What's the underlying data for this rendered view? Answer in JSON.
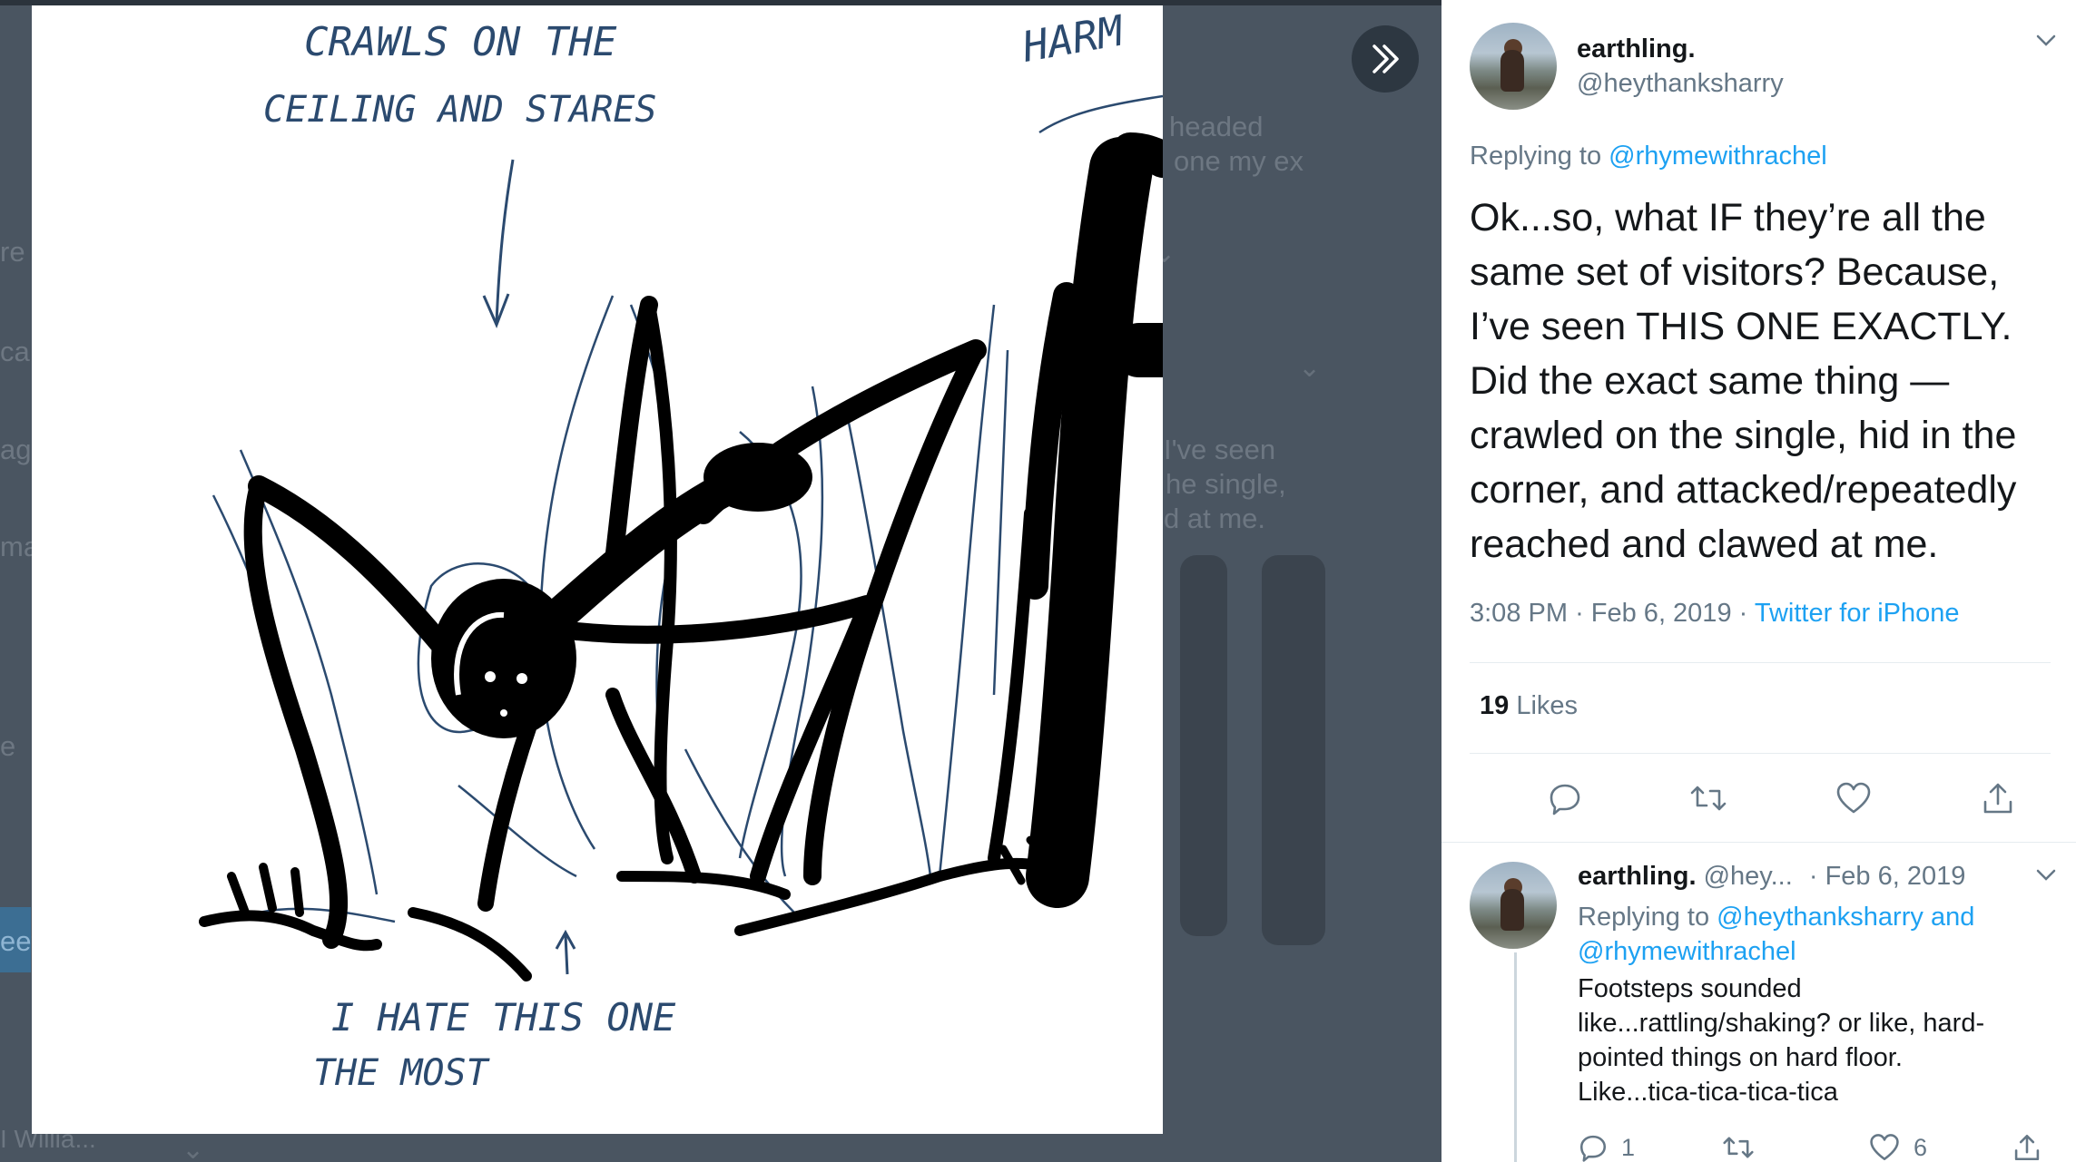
{
  "background_fragments": [
    "headed",
    "one my ex",
    "I've seen",
    "he single,",
    "d at me.",
    "re",
    "ca",
    "ag",
    "ma",
    "e",
    "eet",
    "I Willia..."
  ],
  "drawing": {
    "caption_top_line1": "CRAWLS ON THE",
    "caption_top_line2": "CEILING AND STARES",
    "caption_corner": "HARM",
    "caption_bottom_line1": "I HATE THIS ONE",
    "caption_bottom_line2": "THE MOST"
  },
  "viewer": {
    "collapse_icon": "double-chevron-right-icon"
  },
  "tweet": {
    "author_name": "earthling.",
    "author_handle": "@heythanksharry",
    "replying_prefix": "Replying to",
    "replying_to": "@rhymewithrachel",
    "text": "Ok...so, what IF they’re all the same set of visitors? Because, I’ve seen THIS ONE EXACTLY. Did the exact same thing — crawled on the single, hid in the corner, and attacked/repeatedly reached and clawed at me.",
    "time": "3:08 PM",
    "date": "Feb 6, 2019",
    "source": "Twitter for iPhone",
    "likes_count": "19",
    "likes_label": "Likes",
    "actions": [
      "reply-icon",
      "retweet-icon",
      "like-icon",
      "share-icon"
    ]
  },
  "reply": {
    "author_name": "earthling.",
    "author_handle": "@hey...",
    "date": "· Feb 6, 2019",
    "replying_prefix": "Replying to",
    "replying_to_1": "@heythanksharry",
    "and_word": "and",
    "replying_to_2": "@rhymewithrachel",
    "text_line1": "Footsteps sounded",
    "text_line2": "like...rattling/shaking? or like, hard-",
    "text_line3": "pointed things on hard floor.",
    "text_line4": "Like...tica-tica-tica-tica",
    "reply_count": "1",
    "retweet_count": "",
    "like_count": "6"
  },
  "colors": {
    "link": "#1da1f2",
    "secondary_text": "#657786",
    "ink": "#000000",
    "sketch_blue": "#2b4a6f"
  }
}
